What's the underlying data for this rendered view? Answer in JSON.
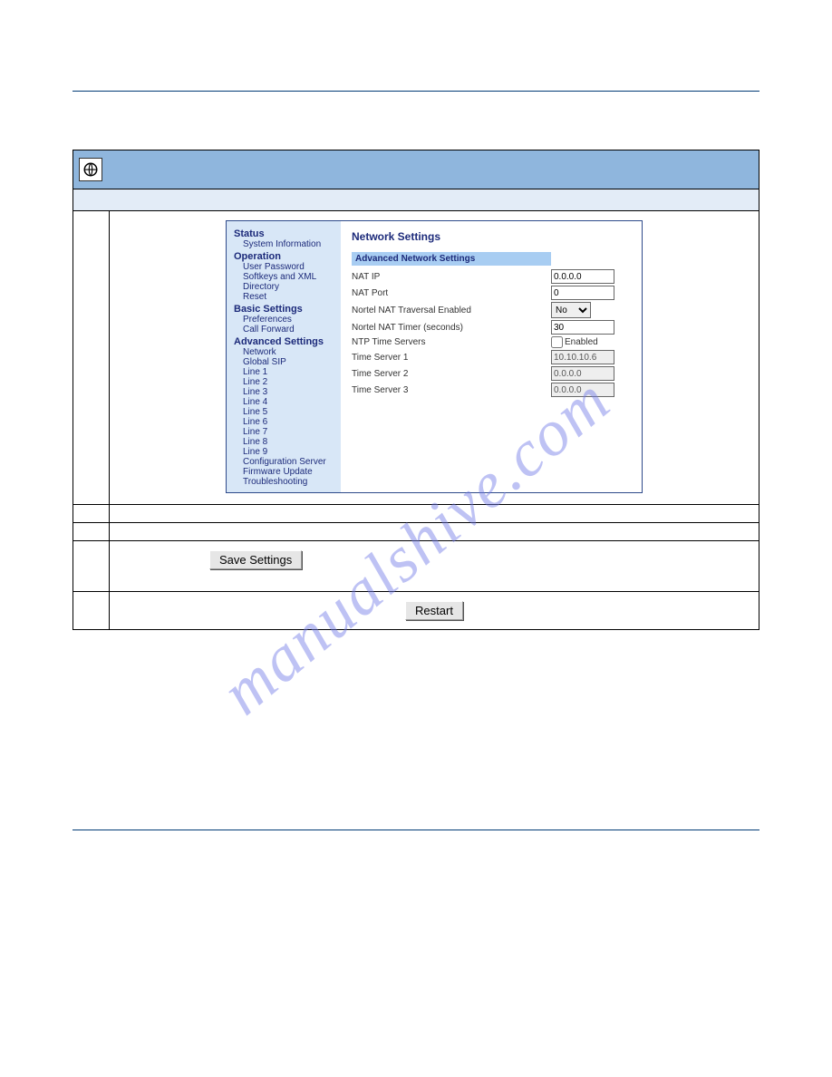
{
  "watermark": "manualshive.com",
  "sidebar": {
    "status_hdr": "Status",
    "system_info": "System Information",
    "operation_hdr": "Operation",
    "user_password": "User Password",
    "softkeys_xml": "Softkeys and XML",
    "directory": "Directory",
    "reset": "Reset",
    "basic_hdr": "Basic Settings",
    "preferences": "Preferences",
    "call_forward": "Call Forward",
    "advanced_hdr": "Advanced Settings",
    "network": "Network",
    "global_sip": "Global SIP",
    "line1": "Line 1",
    "line2": "Line 2",
    "line3": "Line 3",
    "line4": "Line 4",
    "line5": "Line 5",
    "line6": "Line 6",
    "line7": "Line 7",
    "line8": "Line 8",
    "line9": "Line 9",
    "config_server": "Configuration Server",
    "firmware": "Firmware Update",
    "troubleshooting": "Troubleshooting"
  },
  "panel": {
    "title": "Network Settings",
    "subheader": "Advanced Network Settings",
    "nat_ip_label": "NAT IP",
    "nat_ip_value": "0.0.0.0",
    "nat_port_label": "NAT Port",
    "nat_port_value": "0",
    "nortel_trav_label": "Nortel NAT Traversal Enabled",
    "nortel_trav_value": "No",
    "nortel_timer_label": "Nortel NAT Timer (seconds)",
    "nortel_timer_value": "30",
    "ntp_label": "NTP Time Servers",
    "ntp_enabled_label": "Enabled",
    "ts1_label": "Time Server 1",
    "ts1_value": "10.10.10.6",
    "ts2_label": "Time Server 2",
    "ts2_value": "0.0.0.0",
    "ts3_label": "Time Server 3",
    "ts3_value": "0.0.0.0"
  },
  "buttons": {
    "save_settings": "Save Settings",
    "restart": "Restart"
  }
}
